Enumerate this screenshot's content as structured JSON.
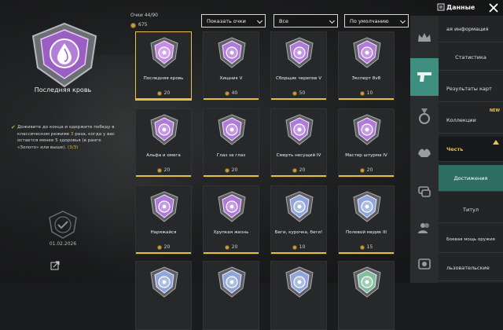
{
  "header": {
    "title": "Данные",
    "points_label": "Очки 44/90",
    "points_value": "675"
  },
  "filters": {
    "show_points": "Показать очки",
    "category": "Все",
    "sort": "По умолчанию"
  },
  "detail": {
    "name": "Последняя кровь",
    "desc_pre": "Доживите до конца и одержите победу в классическом режиме ",
    "desc_num": "3",
    "desc_post": " раза, когда у вас остается менее 5 здоровья (в ранге «Золото» или выше). ",
    "progress": "(3/3)",
    "date": "01.02.2026"
  },
  "achievements": [
    {
      "name": "Последняя кровь",
      "points": "20",
      "color": "#c78be6",
      "icon": "drop-icon"
    },
    {
      "name": "Хищник V",
      "points": "40",
      "color": "#b07ad8",
      "icon": "predator-icon"
    },
    {
      "name": "Сборщик черепов V",
      "points": "50",
      "color": "#b07ad8",
      "icon": "crosshair-icon"
    },
    {
      "name": "Эксперт 8v8",
      "points": "10",
      "color": "#b07ad8",
      "icon": "swords-icon"
    },
    {
      "name": "Альфа и омега",
      "points": "20",
      "color": "#b07ad8",
      "icon": "wolf-icon"
    },
    {
      "name": "Глаз за глаз",
      "points": "20",
      "color": "#b07ad8",
      "icon": "skull-icon"
    },
    {
      "name": "Смерть несущий IV",
      "points": "20",
      "color": "#b07ad8",
      "icon": "bolt-icon"
    },
    {
      "name": "Мастер штурма IV",
      "points": "20",
      "color": "#b07ad8",
      "icon": "target-icon"
    },
    {
      "name": "Наряжайся",
      "points": "20",
      "color": "#b07ad8",
      "icon": "wardrobe-icon"
    },
    {
      "name": "Хрупкая жизнь",
      "points": "20",
      "color": "#b07ad8",
      "icon": "bandage-icon"
    },
    {
      "name": "Беги, курочка, беги!",
      "points": "10",
      "color": "#8fa7d8",
      "icon": "chevrons-icon"
    },
    {
      "name": "Полевой медик III",
      "points": "15",
      "color": "#8fa7d8",
      "icon": "medic-icon"
    },
    {
      "name": "",
      "points": "",
      "color": "#8fa7d8",
      "icon": "badge-icon"
    },
    {
      "name": "",
      "points": "",
      "color": "#8fa7d8",
      "icon": "badge-icon"
    },
    {
      "name": "",
      "points": "",
      "color": "#8fa7d8",
      "icon": "badge-icon"
    },
    {
      "name": "",
      "points": "",
      "color": "#7fbf9a",
      "icon": "badge-icon"
    }
  ],
  "sub_menu": [
    "ая информация",
    "Статистика",
    "Результаты карт",
    "Коллекции",
    "Честь",
    "Достижения",
    "Титул",
    "Боевая мощь оружия",
    "льзовательские"
  ],
  "new_tag": "NEW",
  "colors": {
    "accent": "#e8c34a",
    "teal": "#3f8f80"
  }
}
